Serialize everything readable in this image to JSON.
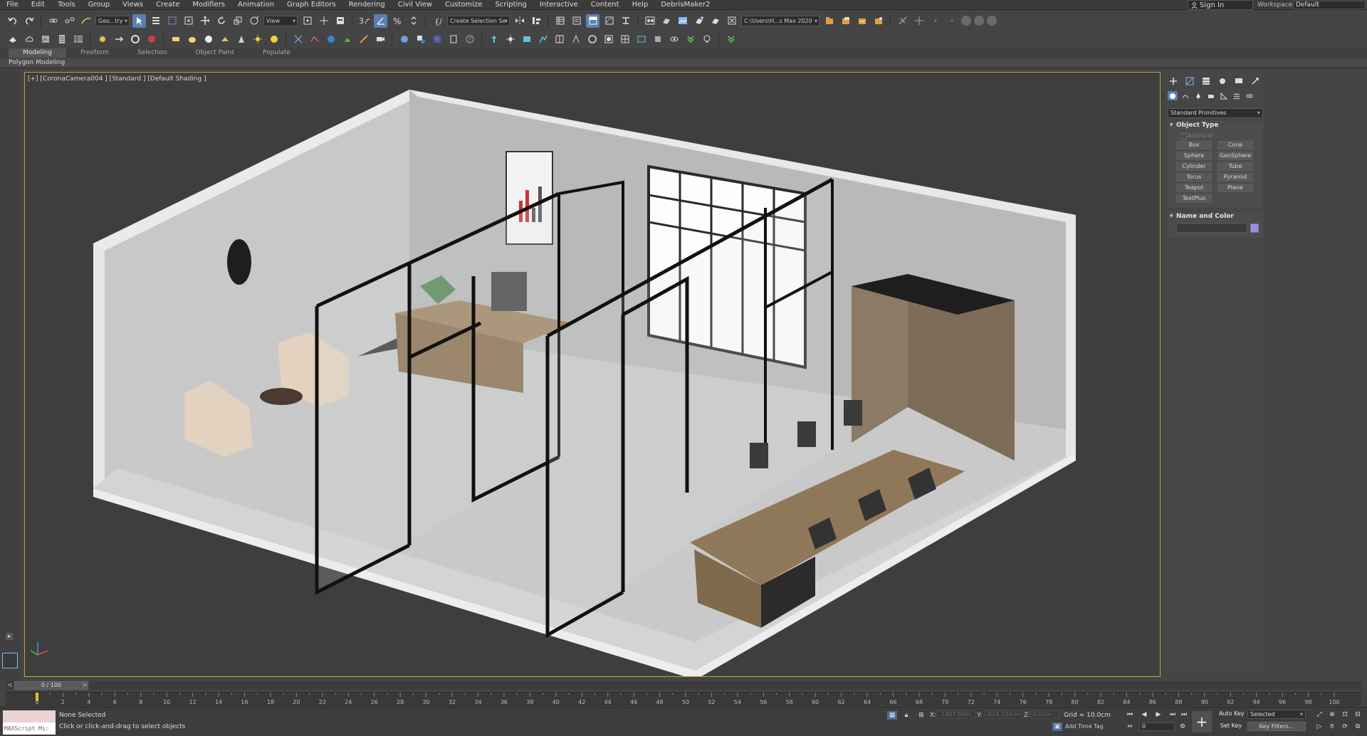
{
  "menu": [
    "File",
    "Edit",
    "Tools",
    "Group",
    "Views",
    "Create",
    "Modifiers",
    "Animation",
    "Graph Editors",
    "Rendering",
    "Civil View",
    "Customize",
    "Scripting",
    "Interactive",
    "Content",
    "Help",
    "DebrisMaker2"
  ],
  "account": {
    "signin": "Sign In",
    "workspaces_label": "Workspaces:",
    "workspace": "Default"
  },
  "toolbar": {
    "selection_filter": "Geo...try",
    "reference_coord": "View",
    "named_selection": "Create Selection Se",
    "project_path": "C:\\Users\\H...s Max 2020"
  },
  "ribbon": {
    "tabs": [
      "Modeling",
      "Freeform",
      "Selection",
      "Object Paint",
      "Populate"
    ],
    "active": "Modeling",
    "panel": "Polygon Modeling"
  },
  "viewport": {
    "label": "[+] [CoronaCamera004 ] [Standard ] [Default Shading ]"
  },
  "command_panel": {
    "category": "Standard Primitives",
    "object_type_title": "Object Type",
    "autogrid": "AutoGrid",
    "objects": [
      "Box",
      "Cone",
      "Sphere",
      "GeoSphere",
      "Cylinder",
      "Tube",
      "Torus",
      "Pyramid",
      "Teapot",
      "Plane",
      "TextPlus"
    ],
    "name_color_title": "Name and Color",
    "object_color": "#9a8cf0"
  },
  "timeline": {
    "frame_display": "0 / 100",
    "ticks": [
      0,
      2,
      4,
      6,
      8,
      10,
      12,
      14,
      16,
      18,
      20,
      22,
      24,
      26,
      28,
      30,
      32,
      34,
      36,
      38,
      40,
      42,
      44,
      46,
      48,
      50,
      52,
      54,
      56,
      58,
      60,
      62,
      64,
      66,
      68,
      70,
      72,
      74,
      76,
      78,
      80,
      82,
      84,
      86,
      88,
      90,
      92,
      94,
      96,
      98,
      100
    ]
  },
  "status": {
    "maxscript": "MAXScript Mi:",
    "selection": "None Selected",
    "prompt": "Click or click-and-drag to select objects",
    "x_label": "X:",
    "x_value": "-1487.066c",
    "y_label": "Y:",
    "y_value": "-824.224cm",
    "z_label": "Z:",
    "z_value": "0.0cm",
    "grid": "Grid = 10.0cm",
    "add_time_tag": "Add Time Tag",
    "auto_key": "Auto Key",
    "set_key": "Set Key",
    "selected": "Selected",
    "key_filters": "Key Filters...",
    "current_frame": "0"
  }
}
